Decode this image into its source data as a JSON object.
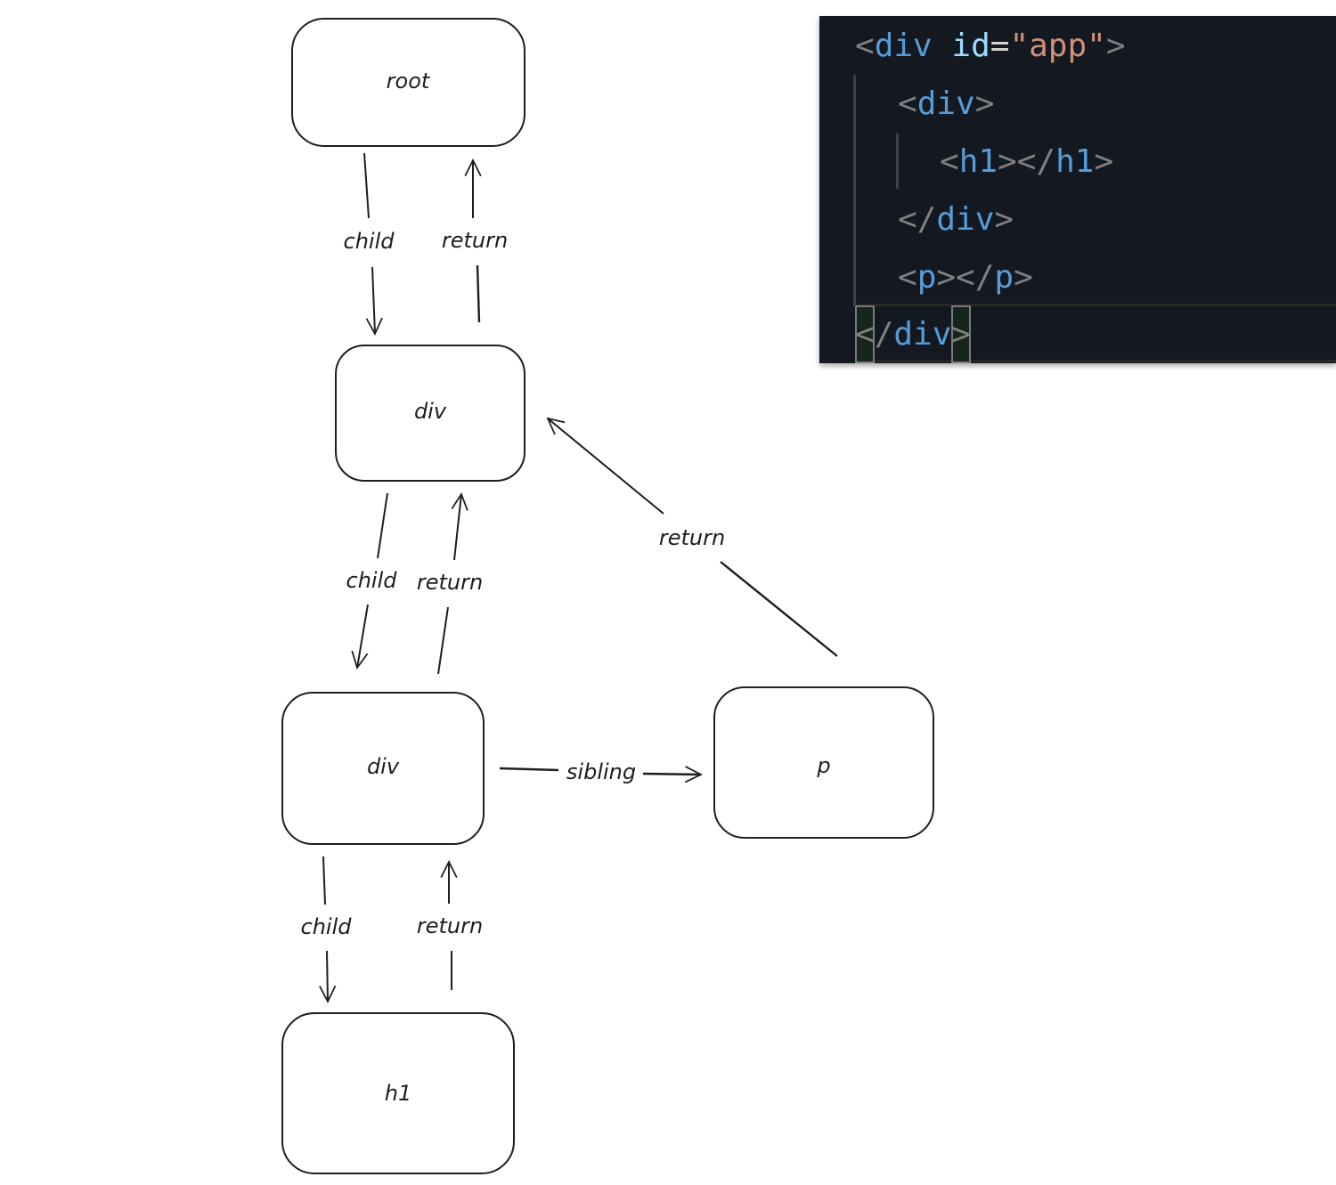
{
  "diagram": {
    "nodes": [
      {
        "id": "root",
        "label": "root"
      },
      {
        "id": "div1",
        "label": "div"
      },
      {
        "id": "div2",
        "label": "div"
      },
      {
        "id": "p",
        "label": "p"
      },
      {
        "id": "h1",
        "label": "h1"
      }
    ],
    "edges": [
      {
        "from": "root",
        "to": "div1",
        "label": "child"
      },
      {
        "from": "div1",
        "to": "root",
        "label": "return"
      },
      {
        "from": "div1",
        "to": "div2",
        "label": "child"
      },
      {
        "from": "div2",
        "to": "div1",
        "label": "return"
      },
      {
        "from": "div2",
        "to": "h1",
        "label": "child"
      },
      {
        "from": "h1",
        "to": "div2",
        "label": "return"
      },
      {
        "from": "div2",
        "to": "p",
        "label": "sibling"
      },
      {
        "from": "p",
        "to": "div1",
        "label": "return"
      }
    ]
  },
  "code": {
    "line1": {
      "open": "<",
      "tag": "div",
      "attr": "id",
      "eq": "=",
      "value": "\"app\"",
      "close": ">"
    },
    "line2": {
      "open": "<",
      "tag": "div",
      "close": ">"
    },
    "line3": {
      "open": "<",
      "tag": "h1",
      "mid": "></",
      "tag2": "h1",
      "close": ">"
    },
    "line4": {
      "open": "</",
      "tag": "div",
      "close": ">"
    },
    "line5": {
      "open": "<",
      "tag": "p",
      "mid": "></",
      "tag2": "p",
      "close": ">"
    },
    "line6": {
      "open": "<",
      "slash": "/",
      "tag": "div",
      "close": ">"
    }
  },
  "colors": {
    "code_bg": "#141821",
    "tag": "#569cd6",
    "attribute": "#9cdcfe",
    "string": "#ce9178",
    "punctuation": "#808080",
    "stroke": "#1e1e1e"
  }
}
